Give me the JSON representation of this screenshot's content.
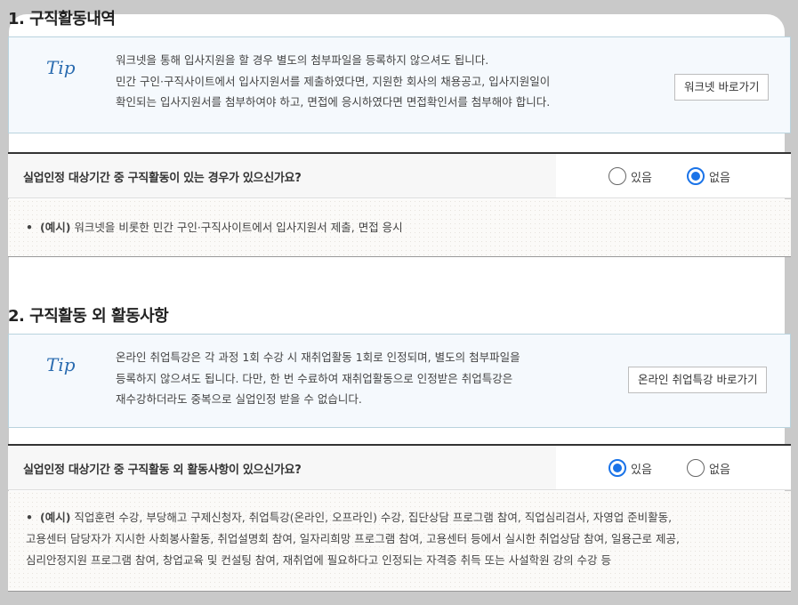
{
  "section1": {
    "title": "1. 구직활동내역",
    "tip": {
      "mark": "Tip",
      "lines": [
        "워크넷을 통해 입사지원을 할 경우 별도의 첨부파일을 등록하지 않으셔도 됩니다.",
        "민간 구인·구직사이트에서 입사지원서를 제출하였다면, 지원한 회사의 채용공고, 입사지원일이",
        "확인되는 입사지원서를 첨부하여야 하고, 면접에 응시하였다면 면접확인서를 첨부해야 합니다."
      ],
      "button": "워크넷 바로가기"
    },
    "question": "실업인정 대상기간 중 구직활동이 있는 경우가 있으신가요?",
    "options": {
      "yes": "있음",
      "no": "없음"
    },
    "selected": "no",
    "example": {
      "bullet": "•",
      "label": "(예시)",
      "lines": [
        "워크넷을 비롯한 민간 구인·구직사이트에서 입사지원서 제출, 면접 응시"
      ]
    }
  },
  "section2": {
    "title": "2. 구직활동 외 활동사항",
    "tip": {
      "mark": "Tip",
      "lines": [
        "온라인 취업특강은 각 과정 1회 수강 시 재취업활동 1회로 인정되며, 별도의 첨부파일을",
        "등록하지 않으셔도 됩니다. 다만, 한 번 수료하여 재취업활동으로 인정받은 취업특강은",
        "재수강하더라도 중복으로 실업인정 받을 수 없습니다."
      ],
      "button": "온라인 취업특강 바로가기"
    },
    "question": "실업인정 대상기간 중 구직활동 외 활동사항이 있으신가요?",
    "options": {
      "yes": "있음",
      "no": "없음"
    },
    "selected": "yes",
    "example": {
      "bullet": "•",
      "label": "(예시)",
      "lines": [
        "직업훈련 수강, 부당해고 구제신청자, 취업특강(온라인, 오프라인) 수강, 집단상담 프로그램 참여, 직업심리검사, 자영업 준비활동,",
        "고용센터 담당자가 지시한 사회봉사활동, 취업설명회 참여, 일자리희망 프로그램 참여, 고용센터 등에서 실시한 취업상담 참여, 일용근로 제공,",
        "심리안정지원 프로그램 참여, 창업교육 및 컨설팅 참여, 재취업에 필요하다고 인정되는 자격증 취득 또는 사설학원 강의 수강 등"
      ]
    }
  },
  "colors": {
    "accent": "#1a73e8",
    "tip_bg": "#f5f9fd",
    "tip_border": "#b9d3de"
  }
}
